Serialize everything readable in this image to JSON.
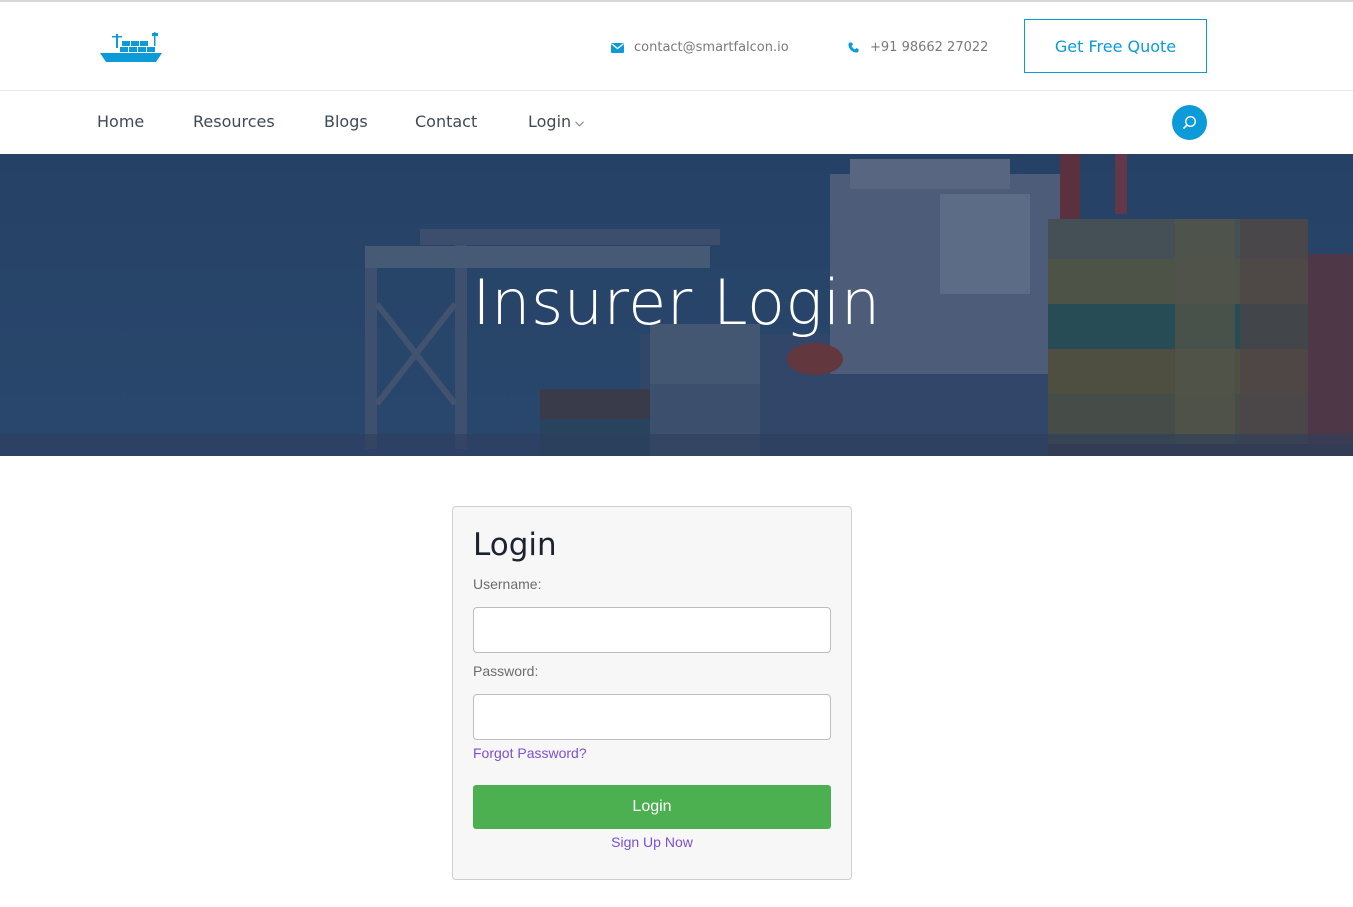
{
  "header": {
    "email": "contact@smartfalcon.io",
    "phone": "+91 98662 27022",
    "quote_button": "Get Free Quote"
  },
  "nav": {
    "items": [
      "Home",
      "Resources",
      "Blogs",
      "Contact",
      "Login"
    ]
  },
  "hero": {
    "title": "Insurer Login"
  },
  "login": {
    "title": "Login",
    "username_label": "Username:",
    "password_label": "Password:",
    "forgot_link": "Forgot Password?",
    "submit_label": "Login",
    "signup_link": "Sign Up Now"
  },
  "colors": {
    "brand_blue": "#0d9ad8",
    "login_green": "#4caf50",
    "link_purple": "#7b4fd6"
  },
  "icons": [
    "ship-logo",
    "email-icon",
    "phone-icon",
    "chevron-down-icon",
    "search-icon"
  ]
}
